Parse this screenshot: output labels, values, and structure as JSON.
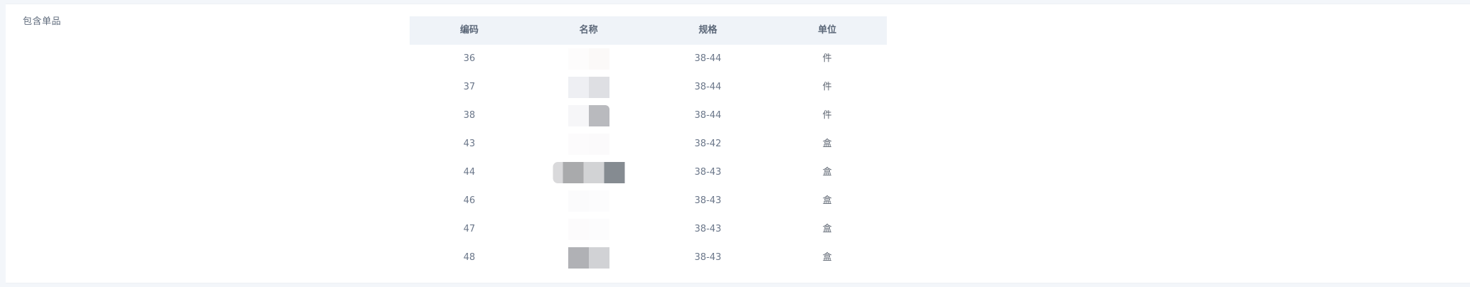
{
  "section": {
    "label": "包含单品"
  },
  "table": {
    "headers": [
      "编码",
      "名称",
      "规格",
      "单位"
    ],
    "rows": [
      {
        "code": "36",
        "name": "",
        "spec": "38-44",
        "unit": "件"
      },
      {
        "code": "37",
        "name": "",
        "spec": "38-44",
        "unit": "件"
      },
      {
        "code": "38",
        "name": "",
        "spec": "38-44",
        "unit": "件"
      },
      {
        "code": "43",
        "name": "",
        "spec": "38-42",
        "unit": "盒"
      },
      {
        "code": "44",
        "name": "",
        "spec": "38-43",
        "unit": "盒"
      },
      {
        "code": "46",
        "name": "",
        "spec": "38-43",
        "unit": "盒"
      },
      {
        "code": "47",
        "name": "",
        "spec": "38-43",
        "unit": "盒"
      },
      {
        "code": "48",
        "name": "",
        "spec": "38-43",
        "unit": "盒"
      }
    ]
  }
}
